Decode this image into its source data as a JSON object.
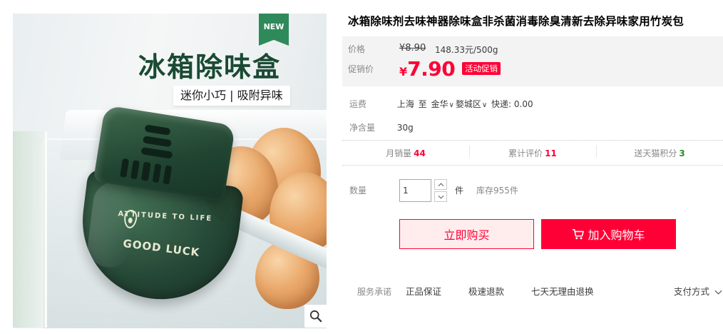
{
  "image": {
    "badge": "NEW",
    "headline": "冰箱除味盒",
    "subline": "迷你小巧 | 吸附异味",
    "print_arc": "ATTITUDE TO LIFE",
    "print_main": "GOOD LUCK",
    "zoom_icon": "search-icon"
  },
  "product": {
    "title": "冰箱除味剂去味神器除味盒非杀菌消毒除臭清新去除异味家用竹炭包"
  },
  "price": {
    "label": "价格",
    "original": "¥8.90",
    "unit_price": "148.33元/500g",
    "promo_label": "促销价",
    "currency": "¥",
    "promo_value": "7.90",
    "promo_tag": "活动促销",
    "accent_color": "#ff0036"
  },
  "shipping": {
    "label": "运费",
    "origin": "上海",
    "to": "至",
    "dest_city": "金华",
    "dest_district": "婺城区",
    "express": "快递: 0.00"
  },
  "weight": {
    "label": "净含量",
    "value": "30g"
  },
  "stats": [
    {
      "label": "月销量",
      "value": "44",
      "color": "red"
    },
    {
      "label": "累计评价",
      "value": "11",
      "color": "red"
    },
    {
      "label": "送天猫积分",
      "value": "3",
      "color": "green"
    }
  ],
  "quantity": {
    "label": "数量",
    "value": "1",
    "unit": "件",
    "stock": "库存955件"
  },
  "actions": {
    "buy_now": "立即购买",
    "add_to_cart": "加入购物车"
  },
  "service": {
    "label": "服务承诺",
    "items": [
      "正品保证",
      "极速退款",
      "七天无理由退换"
    ],
    "payment": "支付方式"
  }
}
